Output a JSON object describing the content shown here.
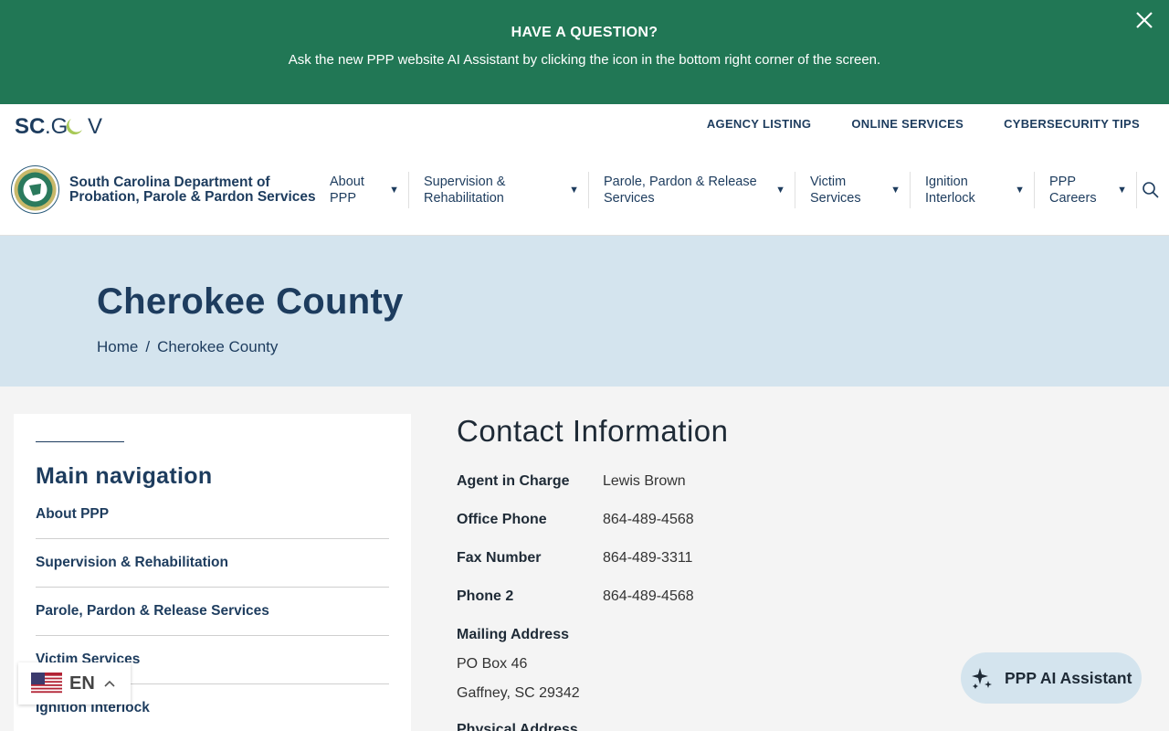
{
  "banner": {
    "title": "HAVE A QUESTION?",
    "text": "Ask the new PPP website AI Assistant by clicking the icon in the bottom right corner of the screen."
  },
  "header": {
    "scgov_logo": "SC.GOV",
    "utility_links": [
      "AGENCY LISTING",
      "ONLINE SERVICES",
      "CYBERSECURITY TIPS"
    ],
    "agency_name_line1": "South Carolina Department of",
    "agency_name_line2": "Probation, Parole & Pardon Services",
    "nav": [
      {
        "line1": "About",
        "line2": "PPP"
      },
      {
        "line1": "Supervision &",
        "line2": "Rehabilitation"
      },
      {
        "line1": "Parole, Pardon & Release",
        "line2": "Services"
      },
      {
        "line1": "Victim",
        "line2": "Services"
      },
      {
        "line1": "Ignition",
        "line2": "Interlock"
      },
      {
        "line1": "PPP",
        "line2": "Careers"
      }
    ]
  },
  "hero": {
    "title": "Cherokee County",
    "breadcrumb_home": "Home",
    "breadcrumb_sep": "/",
    "breadcrumb_current": "Cherokee County"
  },
  "sidebar": {
    "title": "Main navigation",
    "items": [
      "About PPP",
      "Supervision & Rehabilitation",
      "Parole, Pardon & Release Services",
      "Victim Services",
      "Ignition Interlock"
    ]
  },
  "contact": {
    "heading": "Contact Information",
    "agent_label": "Agent in Charge",
    "agent_value": "Lewis Brown",
    "office_label": "Office Phone",
    "office_value": "864-489-4568",
    "fax_label": "Fax Number",
    "fax_value": "864-489-3311",
    "phone2_label": "Phone 2",
    "phone2_value": "864-489-4568",
    "mailing_label": "Mailing Address",
    "mailing_line1": "PO Box 46",
    "mailing_line2": "Gaffney, SC 29342",
    "physical_label": "Physical Address"
  },
  "language": {
    "code": "EN"
  },
  "ai_assistant": {
    "label": "PPP AI Assistant"
  },
  "colors": {
    "banner_green": "#217755",
    "navy": "#1d3c5e",
    "hero_blue": "#d4e4ee"
  }
}
